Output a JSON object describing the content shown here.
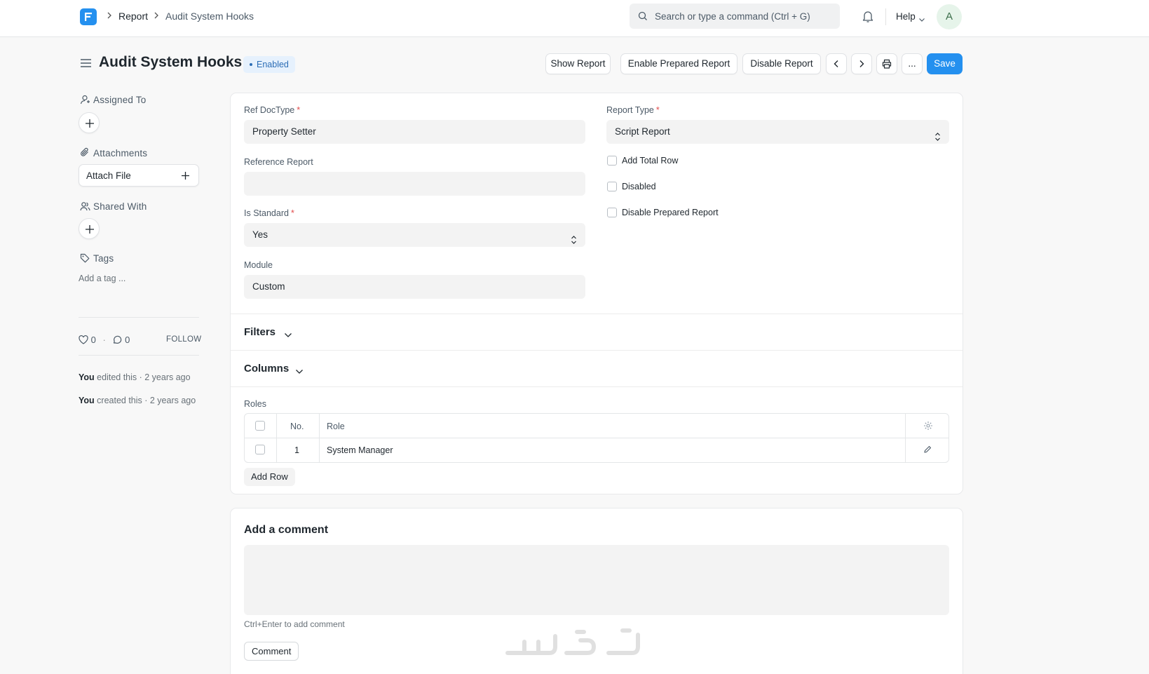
{
  "navbar": {
    "breadcrumbs": [
      "Report",
      "Audit System Hooks"
    ],
    "search_placeholder": "Search or type a command (Ctrl + G)",
    "help_label": "Help",
    "avatar_initial": "A"
  },
  "header": {
    "title": "Audit System Hooks",
    "status": "Enabled",
    "buttons": {
      "show_report": "Show Report",
      "enable_prepared": "Enable Prepared Report",
      "disable_report": "Disable Report",
      "more": "...",
      "save": "Save"
    }
  },
  "sidebar": {
    "assigned_to": "Assigned To",
    "attachments": "Attachments",
    "attach_file": "Attach File",
    "shared_with": "Shared With",
    "tags": "Tags",
    "add_tag": "Add a tag ...",
    "likes": "0",
    "comments": "0",
    "follow": "FOLLOW",
    "activity": [
      {
        "who": "You",
        "what": " edited this · 2 years ago"
      },
      {
        "who": "You",
        "what": " created this · 2 years ago"
      }
    ]
  },
  "form": {
    "ref_doctype": {
      "label": "Ref DocType",
      "value": "Property Setter"
    },
    "reference_report": {
      "label": "Reference Report",
      "value": ""
    },
    "is_standard": {
      "label": "Is Standard",
      "value": "Yes"
    },
    "module": {
      "label": "Module",
      "value": "Custom"
    },
    "report_type": {
      "label": "Report Type",
      "value": "Script Report"
    },
    "checkboxes": {
      "add_total_row": "Add Total Row",
      "disabled": "Disabled",
      "disable_prepared_report": "Disable Prepared Report"
    },
    "sections": {
      "filters": "Filters",
      "columns": "Columns"
    },
    "roles": {
      "label": "Roles",
      "headers": {
        "no": "No.",
        "role": "Role"
      },
      "rows": [
        {
          "no": "1",
          "role": "System Manager"
        }
      ],
      "add_row": "Add Row"
    }
  },
  "comment": {
    "title": "Add a comment",
    "hint": "Ctrl+Enter to add comment",
    "button": "Comment"
  },
  "colors": {
    "primary": "#2490ef",
    "badge_bg": "#e6f1fd",
    "required": "#e24c4c"
  }
}
